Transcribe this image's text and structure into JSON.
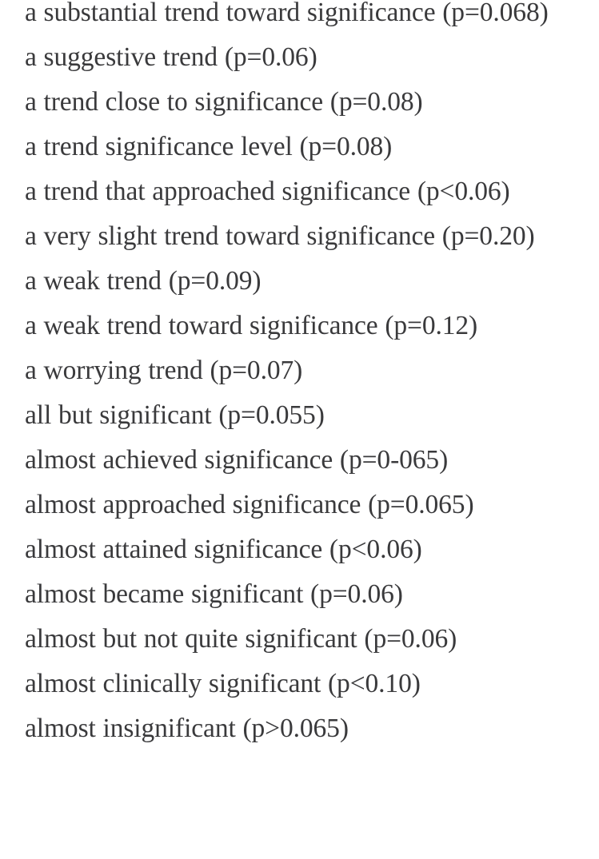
{
  "document": {
    "type": "scrolled-text-list",
    "background_color": "#ffffff",
    "text_color": "#3a3a3c",
    "first_item_clipped_top": true,
    "last_item_clipped_bottom": true,
    "items": [
      "a substantial trend toward significance (p=0.068)",
      "a suggestive trend (p=0.06)",
      "a trend close to significance (p=0.08)",
      "a trend significance level (p=0.08)",
      "a trend that approached significance (p<0.06)",
      "a very slight trend toward significance (p=0.20)",
      "a weak trend (p=0.09)",
      "a weak trend toward significance (p=0.12)",
      "a worrying trend (p=0.07)",
      "all but significant (p=0.055)",
      "almost achieved significance (p=0-065)",
      "almost approached significance (p=0.065)",
      "almost attained significance (p<0.06)",
      "almost became significant (p=0.06)",
      "almost but not quite significant (p=0.06)",
      "almost clinically significant (p<0.10)",
      "almost insignificant (p>0.065)"
    ]
  }
}
